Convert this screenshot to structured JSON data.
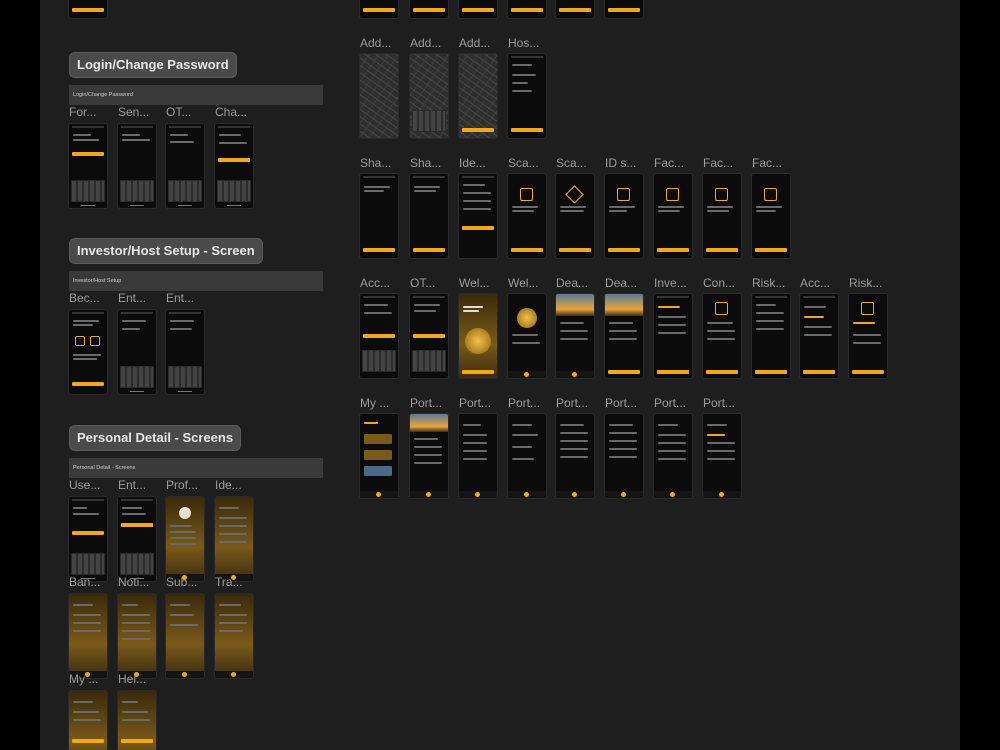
{
  "sections": [
    {
      "id": "login",
      "title": "Login/Change Password",
      "bar": "Login/Change Password"
    },
    {
      "id": "investor",
      "title": "Investor/Host Setup - Screen",
      "bar": "Investor/Host Setup"
    },
    {
      "id": "personal",
      "title": "Personal Detail - Screens",
      "bar": "Personal Detail - Screens"
    }
  ],
  "labels": {
    "login": [
      "For...",
      "Sen...",
      "OT...",
      "Cha..."
    ],
    "investor": [
      "Bec...",
      "Ent...",
      "Ent..."
    ],
    "personal_r1": [
      "Use...",
      "Ent...",
      "Prof...",
      "Ide..."
    ],
    "personal_r2": [
      "Ban...",
      "Noti...",
      "Sub...",
      "Tra..."
    ],
    "personal_r3": [
      "My ...",
      "Hel..."
    ],
    "right_r1": [
      "Add...",
      "Add...",
      "Add...",
      "Hos..."
    ],
    "right_r2": [
      "Sha...",
      "Sha...",
      "Ide...",
      "Sca...",
      "Sca...",
      "ID s...",
      "Fac...",
      "Fac...",
      "Fac..."
    ],
    "right_r3": [
      "Acc...",
      "OT...",
      "Wel...",
      "Wel...",
      "Dea...",
      "Dea...",
      "Inve...",
      "Con...",
      "Risk...",
      "Acc...",
      "Risk..."
    ],
    "right_r4": [
      "My ...",
      "Port...",
      "Port...",
      "Port...",
      "Port...",
      "Port...",
      "Port...",
      "Port..."
    ]
  },
  "colors": {
    "accent": "#f2a917",
    "canvas": "#1e1e1e",
    "section": "#4a4a4a"
  }
}
